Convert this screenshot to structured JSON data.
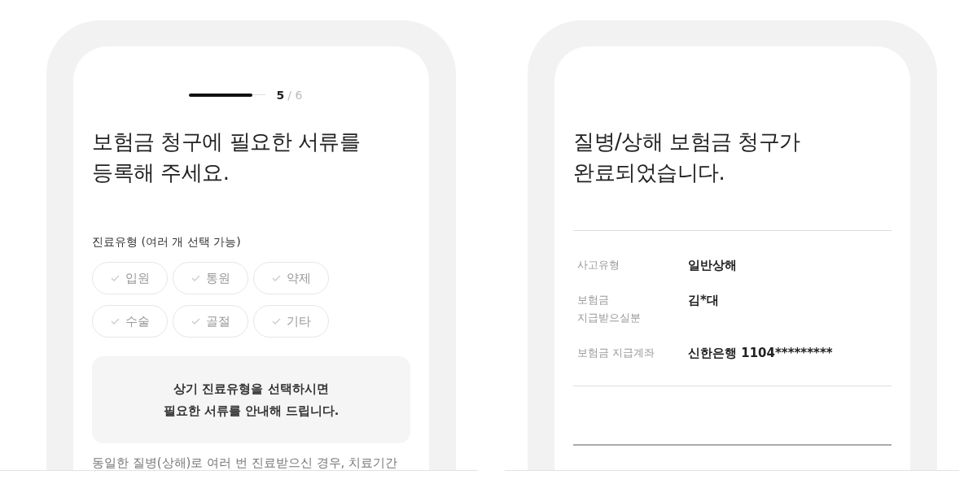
{
  "claim_form": {
    "progress": {
      "level": 0.83,
      "current": "5",
      "total": "/ 6"
    },
    "title": "보험금 청구에 필요한 서류를\n등록해 주세요.",
    "section_label": "진료유형 (여러 개 선택 가능)",
    "options": [
      {
        "label": "입원",
        "selected": false
      },
      {
        "label": "통원",
        "selected": false
      },
      {
        "label": "약제",
        "selected": false
      },
      {
        "label": "수술",
        "selected": false
      },
      {
        "label": "골절",
        "selected": false
      },
      {
        "label": "기타",
        "selected": false
      }
    ],
    "info_message": "상기 진료유형을 선택하시면\n필요한 서류를 안내해 드립니다.",
    "footnote": "동일한 질병(상해)로 여러 번 진료받으신 경우, 치료기간"
  },
  "claim_complete": {
    "title": "질병/상해 보험금 청구가\n완료되었습니다.",
    "details": [
      {
        "label": "사고유형",
        "value": "일반상해"
      },
      {
        "label": "보험금\n지급받으실분",
        "value": "김*대"
      },
      {
        "label": "보험금 지급계좌",
        "value": "신한은행 1104*********"
      }
    ]
  }
}
